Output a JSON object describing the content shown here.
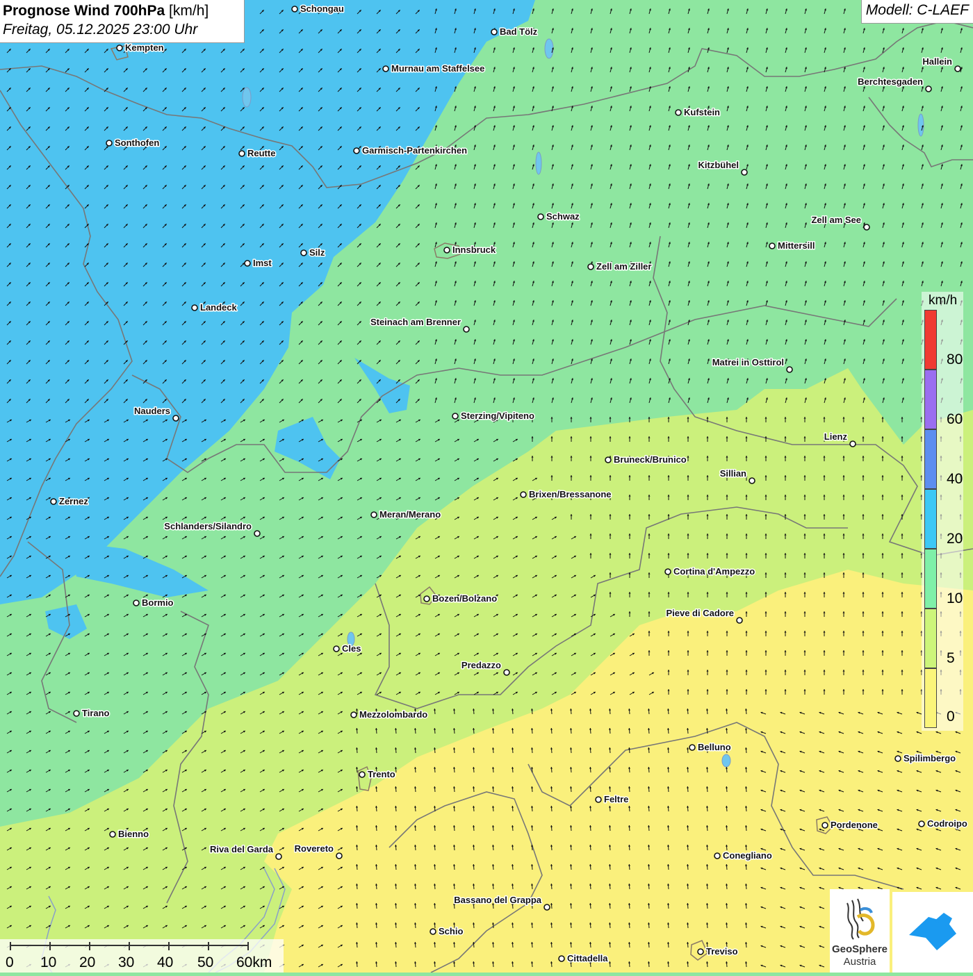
{
  "header": {
    "title_bold": "Prognose Wind 700hPa",
    "title_unit": "[km/h]",
    "datetime": "Freitag, 05.12.2025 23:00 Uhr"
  },
  "model": "Modell: C-LAEF",
  "legend": {
    "unit": "km/h",
    "classes": [
      {
        "label": "80",
        "color": "#f03a32"
      },
      {
        "label": "60",
        "color": "#9a6ef0"
      },
      {
        "label": "40",
        "color": "#5c8ef0"
      },
      {
        "label": "20",
        "color": "#3cc8f5"
      },
      {
        "label": "10",
        "color": "#7ff0a8"
      },
      {
        "label": "5",
        "color": "#cdf57a"
      },
      {
        "label": "0",
        "color": "#fbf57a"
      }
    ]
  },
  "scale_bar": {
    "labels": [
      "0",
      "10",
      "20",
      "30",
      "40",
      "50",
      "60km"
    ]
  },
  "logos": {
    "geosphere_line1": "GeoSphere",
    "geosphere_line2": "Austria"
  },
  "cities": [
    {
      "name": "Schongau"
    },
    {
      "name": "Bad Tölz"
    },
    {
      "name": "Kempten"
    },
    {
      "name": "Murnau am Staffelsee"
    },
    {
      "name": "Hallein"
    },
    {
      "name": "Berchtesgaden"
    },
    {
      "name": "Kufstein"
    },
    {
      "name": "Sonthofen"
    },
    {
      "name": "Reutte"
    },
    {
      "name": "Garmisch-Partenkirchen"
    },
    {
      "name": "Kitzbühel"
    },
    {
      "name": "Schwaz"
    },
    {
      "name": "Zell am See"
    },
    {
      "name": "Mittersill"
    },
    {
      "name": "Innsbruck"
    },
    {
      "name": "Silz"
    },
    {
      "name": "Imst"
    },
    {
      "name": "Zell am Ziller"
    },
    {
      "name": "Landeck"
    },
    {
      "name": "Steinach am Brenner"
    },
    {
      "name": "Matrei in Osttirol"
    },
    {
      "name": "Nauders"
    },
    {
      "name": "Sterzing/Vipiteno"
    },
    {
      "name": "Lienz"
    },
    {
      "name": "Bruneck/Brunico"
    },
    {
      "name": "Sillian"
    },
    {
      "name": "Brixen/Bressanone"
    },
    {
      "name": "Zernez"
    },
    {
      "name": "Meran/Merano"
    },
    {
      "name": "Schlanders/Silandro"
    },
    {
      "name": "Cortina d'Ampezzo"
    },
    {
      "name": "Bozen/Bolzano"
    },
    {
      "name": "Bormio"
    },
    {
      "name": "Pieve di Cadore"
    },
    {
      "name": "Cles"
    },
    {
      "name": "Predazzo"
    },
    {
      "name": "Tirano"
    },
    {
      "name": "Mezzolombardo"
    },
    {
      "name": "Belluno"
    },
    {
      "name": "Spilimbergo"
    },
    {
      "name": "Trento"
    },
    {
      "name": "Feltre"
    },
    {
      "name": "Pordenone"
    },
    {
      "name": "Codroipo"
    },
    {
      "name": "Bienno"
    },
    {
      "name": "Riva del Garda"
    },
    {
      "name": "Rovereto"
    },
    {
      "name": "Conegliano"
    },
    {
      "name": "Bassano del Grappa"
    },
    {
      "name": "Schio"
    },
    {
      "name": "Treviso"
    },
    {
      "name": "Cittadella"
    }
  ]
}
